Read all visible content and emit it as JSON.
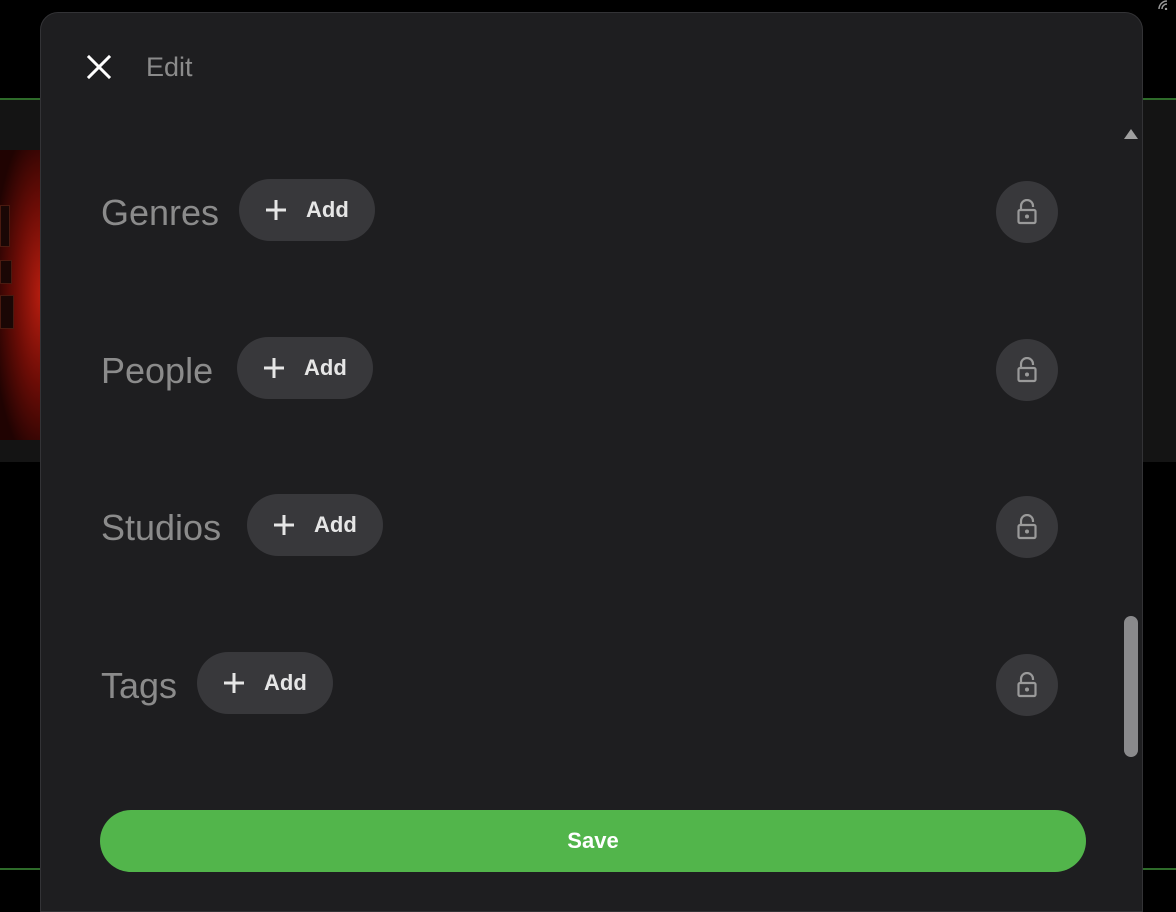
{
  "dialog": {
    "title": "Edit",
    "close_icon": "close-icon"
  },
  "fields": [
    {
      "label": "Genres",
      "add_label": "Add",
      "icon": "plus-icon",
      "lock_icon": "lock-icon"
    },
    {
      "label": "People",
      "add_label": "Add",
      "icon": "plus-icon",
      "lock_icon": "lock-icon"
    },
    {
      "label": "Studios",
      "add_label": "Add",
      "icon": "plus-icon",
      "lock_icon": "lock-icon"
    },
    {
      "label": "Tags",
      "add_label": "Add",
      "icon": "plus-icon",
      "lock_icon": "lock-icon"
    }
  ],
  "footer": {
    "save_label": "Save"
  },
  "colors": {
    "accent": "#52b54b",
    "dialog_bg": "#1e1e20",
    "button_bg": "#38383b",
    "label_text": "#8b8b8b"
  }
}
